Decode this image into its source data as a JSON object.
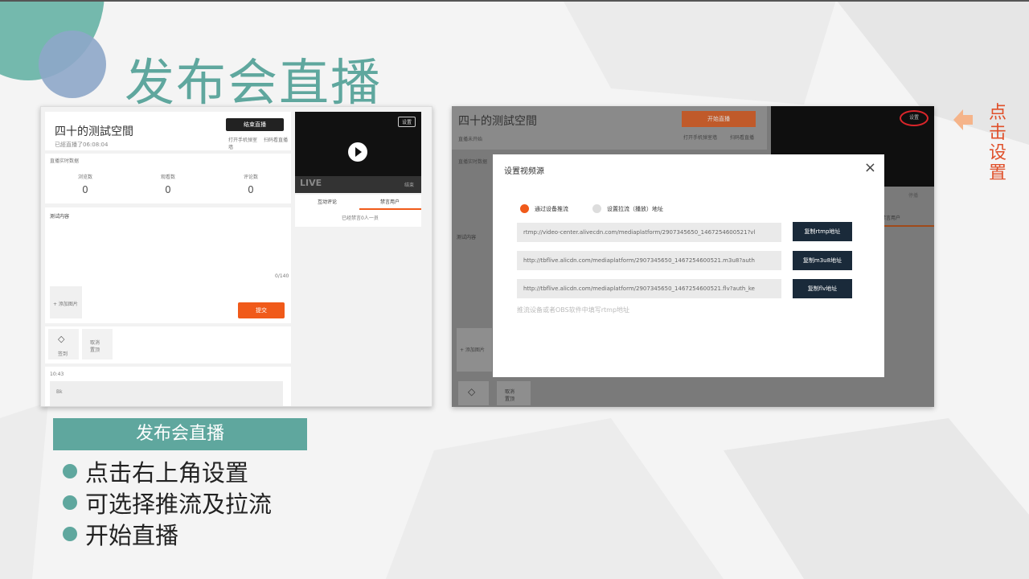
{
  "slide": {
    "title": "发布会直播",
    "caption": "发布会直播",
    "bullets": [
      "点击右上角设置",
      "可选择推流及拉流",
      "开始直播"
    ],
    "side_note": [
      "点",
      "击",
      "设",
      "置"
    ]
  },
  "colors": {
    "teal": "#5fa79e",
    "orange": "#f05a1a",
    "red": "#d9252a",
    "navy": "#1a2a3a"
  },
  "left_ui": {
    "room_title": "四十的测試空間",
    "status": "已經直播了06:08:04",
    "end_button": "结束直播",
    "open_phone": "打开手机弹室墙",
    "scan": "扫码看直播",
    "stats_header": "直播实时数据",
    "stats": [
      {
        "label": "浏览数",
        "value": "0"
      },
      {
        "label": "观看数",
        "value": "0"
      },
      {
        "label": "评论数",
        "value": "0"
      }
    ],
    "test_content": "测试内容",
    "count": "0/140",
    "add_image": "+ 添加图片",
    "submit": "提交",
    "tags": [
      "签到",
      "取消\n置顶"
    ],
    "time": "10:43",
    "message": "Bk",
    "settings_chip": "设置",
    "live": "LIVE",
    "live_right": "结束",
    "tab_interact": "互动评论",
    "tab_banned": "禁言用户",
    "banned_count": "已经禁言0人一员"
  },
  "right_ui": {
    "room_title": "四十的测試空間",
    "status": "直播未开始",
    "start_button": "开始直播",
    "open_phone": "打开手机弹室墙",
    "scan": "扫码看直播",
    "stats_header": "直播实时数据",
    "test_content": "测试内容",
    "add_image": "+ 添加图片",
    "tag": "取消\n置顶",
    "settings_chip": "设置",
    "stop": "停播",
    "banned": "禁言用户"
  },
  "dialog": {
    "title": "设置视频源",
    "close": "×",
    "option_push": "通过设备推流",
    "option_pull": "设置拉流（播放）地址",
    "rows": [
      {
        "url": "rtmp://video-center.alivecdn.com/mediaplatform/2907345650_1467254600521?vl",
        "button": "复制rtmp地址"
      },
      {
        "url": "http://tbflive.alicdn.com/mediaplatform/2907345650_1467254600521.m3u8?auth",
        "button": "复制m3u8地址"
      },
      {
        "url": "http://tbflive.alicdn.com/mediaplatform/2907345650_1467254600521.flv?auth_ke",
        "button": "复制flv地址"
      }
    ],
    "hint": "推流设备或者OBS软件中填写rtmp地址"
  }
}
